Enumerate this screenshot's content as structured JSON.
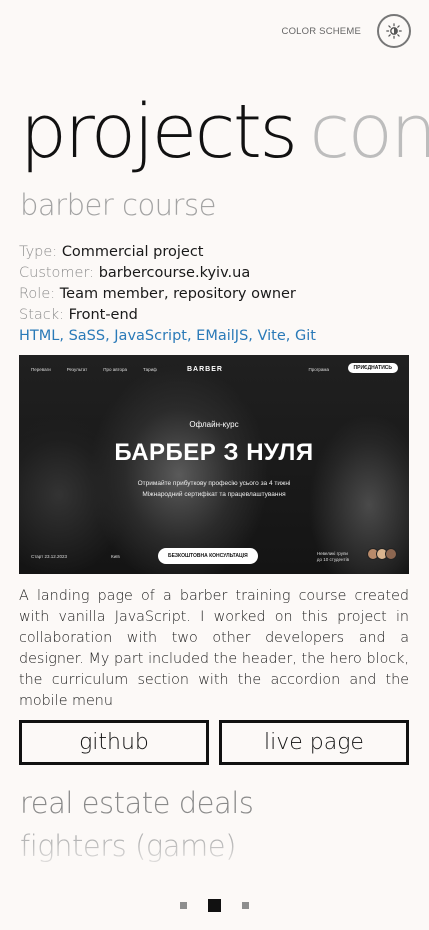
{
  "header": {
    "color_scheme_label": "COLOR SCHEME",
    "color_scheme_icon": "sun-icon"
  },
  "hero": {
    "active_section": "projects",
    "next_section_partial": "con"
  },
  "project": {
    "title": "barber course",
    "meta": {
      "type_key": "Type:",
      "type_value": "Commercial project",
      "customer_key": "Customer:",
      "customer_value": "barbercourse.kyiv.ua",
      "role_key": "Role:",
      "role_value": "Team member, repository owner",
      "stack_key": "Stack:",
      "stack_value": "Front-end",
      "technologies": "HTML, SaSS, JavaScript, EMailJS, Vite, Git"
    },
    "preview": {
      "nav_links": [
        "Переваги",
        "Результат",
        "Про автора",
        "Тариф"
      ],
      "logo": "BARBER",
      "nav_program": "Програма",
      "join_button": "ПРИЄДНАТИСЬ",
      "subtitle": "Офлайн-курс",
      "headline": "БАРБЕР З НУЛЯ",
      "desc_line1": "Отримайте прибуткову професію усього за 4 тижні",
      "desc_line2": "Міжнародний сертифікат та працевлаштування",
      "start": "Старт 23.12.2023",
      "city": "Київ",
      "cta": "БЕЗКОШТОВНА КОНСУЛЬТАЦІЯ",
      "groups_line1": "Невеликі групи",
      "groups_line2": "до 10 студентів"
    },
    "description": "A landing page of a barber training course created with vanilla JavaScript. I worked on this project in collaboration with two other developers and a designer. My part included the header, the hero block, the curriculum section with the accordion and the mobile menu",
    "github_label": "github",
    "live_label": "live page"
  },
  "other_projects": [
    "real estate deals",
    "fighters (game)"
  ],
  "pagination": {
    "total": 3,
    "active_index": 1
  },
  "colors": {
    "background": "#fcf9f7",
    "link": "#2a7ab8",
    "text": "#111111",
    "muted": "#a3a3a3"
  }
}
